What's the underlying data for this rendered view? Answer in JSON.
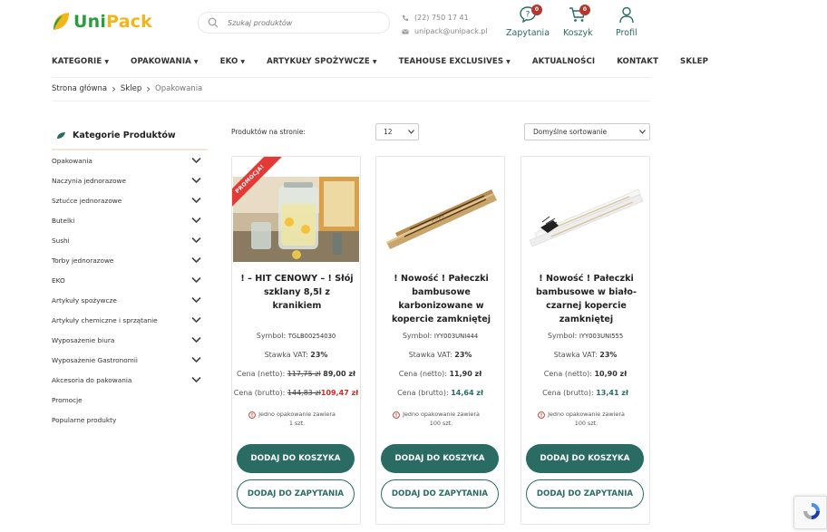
{
  "header": {
    "logo": {
      "part1": "Uni",
      "part2": "Pack"
    },
    "search_placeholder": "Szukaj produktów",
    "phone": "(22) 750 17 41",
    "email": "unipack@unipack.pl",
    "icons": [
      {
        "label": "Zapytania",
        "badge": "0"
      },
      {
        "label": "Koszyk",
        "badge": "0"
      },
      {
        "label": "Profil"
      }
    ]
  },
  "nav": [
    {
      "label": "KATEGORIE",
      "dropdown": true
    },
    {
      "label": "OPAKOWANIA",
      "dropdown": true
    },
    {
      "label": "EKO",
      "dropdown": true
    },
    {
      "label": "ARTYKUŁY SPOŻYWCZE",
      "dropdown": true
    },
    {
      "label": "TEAHOUSE EXCLUSIVES",
      "dropdown": true
    },
    {
      "label": "AKTUALNOŚCI",
      "dropdown": false
    },
    {
      "label": "KONTAKT",
      "dropdown": false
    },
    {
      "label": "SKLEP",
      "dropdown": false
    }
  ],
  "breadcrumb": [
    "Strona główna",
    "Sklep",
    "Opakowania"
  ],
  "sidebar": {
    "title": "Kategorie Produktów",
    "items": [
      {
        "label": "Opakowania",
        "expandable": true
      },
      {
        "label": "Naczynia jednorazowe",
        "expandable": true
      },
      {
        "label": "Sztućce jednorazowe",
        "expandable": true
      },
      {
        "label": "Butelki",
        "expandable": true
      },
      {
        "label": "Sushi",
        "expandable": true
      },
      {
        "label": "Torby jednorazowe",
        "expandable": true
      },
      {
        "label": "EKO",
        "expandable": true
      },
      {
        "label": "Artykuły spożywcze",
        "expandable": true
      },
      {
        "label": "Artykuły chemiczne i sprzątanie",
        "expandable": true
      },
      {
        "label": "Wyposażenie biura",
        "expandable": true
      },
      {
        "label": "Wyposażenie Gastronomii",
        "expandable": true
      },
      {
        "label": "Akcesoria do pakowania",
        "expandable": true
      },
      {
        "label": "Promocje",
        "expandable": false
      },
      {
        "label": "Popularne produkty",
        "expandable": false
      }
    ]
  },
  "toolbar": {
    "per_page_label": "Produktów na stronie:",
    "per_page_value": "12",
    "sort_value": "Domyślne sortowanie"
  },
  "products": [
    {
      "title": "! – HIT CENOWY – ! Słój szklany 8,5l z kranikiem",
      "ribbon": "PROMOCJA!",
      "symbol_label": "Symbol:",
      "symbol": "TGLB00254030",
      "vat_label": "Stawka VAT:",
      "vat": "23%",
      "net_label": "Cena (netto):",
      "net_old": "117,75 zł",
      "net": "89,00 zł",
      "gross_label": "Cena (brutto):",
      "gross_old": "144,83 zł",
      "gross": "109,47 zł",
      "pkg_line1": "Jedno opakowanie zawiera",
      "pkg_line2": "1 szt.",
      "cart_label": "DODAJ DO KOSZYKA",
      "query_label": "DODAJ DO ZAPYTANIA"
    },
    {
      "title": "! Nowość ! Pałeczki bambusowe karbonizowane w kopercie zamkniętej",
      "symbol_label": "Symbol:",
      "symbol": "IYY003UNI444",
      "vat_label": "Stawka VAT:",
      "vat": "23%",
      "net_label": "Cena (netto):",
      "net": "11,90 zł",
      "gross_label": "Cena (brutto):",
      "gross": "14,64 zł",
      "pkg_line1": "Jedno opakowanie zawiera",
      "pkg_line2": "100 szt.",
      "cart_label": "DODAJ DO KOSZYKA",
      "query_label": "DODAJ DO ZAPYTANIA"
    },
    {
      "title": "! Nowość ! Pałeczki bambusowe w biało-czarnej kopercie zamkniętej",
      "symbol_label": "Symbol:",
      "symbol": "IYY003UNI555",
      "vat_label": "Stawka VAT:",
      "vat": "23%",
      "net_label": "Cena (netto):",
      "net": "10,90 zł",
      "gross_label": "Cena (brutto):",
      "gross": "13,41 zł",
      "pkg_line1": "Jedno opakowanie zawiera",
      "pkg_line2": "100 szt.",
      "cart_label": "DODAJ DO KOSZYKA",
      "query_label": "DODAJ DO ZAPYTANIA"
    }
  ],
  "colors": {
    "brand_green": "#2a6b63",
    "logo_yellow": "#f2b51a",
    "logo_green": "#2a9d3f",
    "promo_red": "#d52b2b",
    "badge_red": "#b5362b"
  }
}
